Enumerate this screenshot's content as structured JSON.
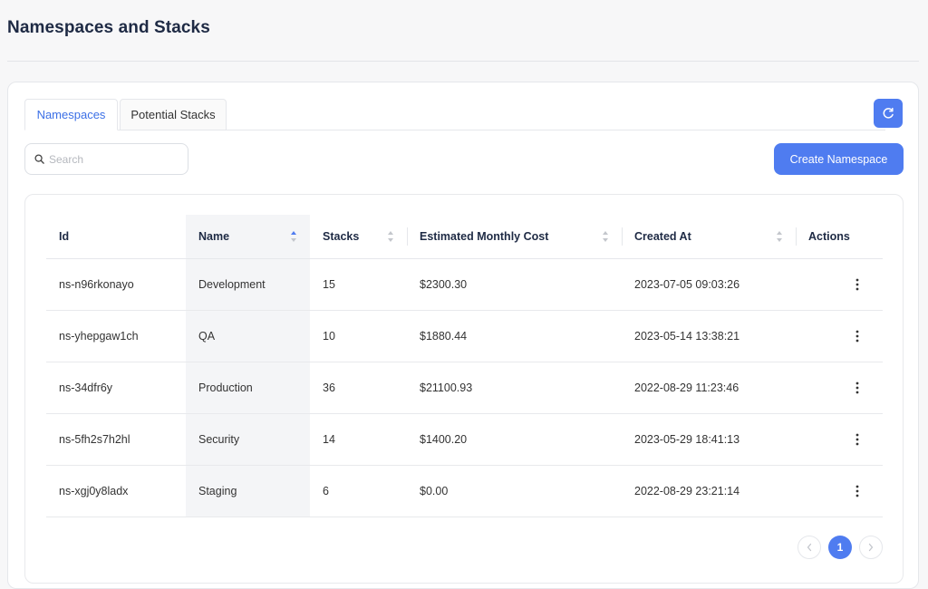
{
  "page": {
    "title": "Namespaces and Stacks"
  },
  "tabs": [
    {
      "label": "Namespaces",
      "active": true
    },
    {
      "label": "Potential Stacks",
      "active": false
    }
  ],
  "search": {
    "placeholder": "Search",
    "value": ""
  },
  "toolbar": {
    "create_label": "Create Namespace"
  },
  "table": {
    "columns": [
      "Id",
      "Name",
      "Stacks",
      "Estimated Monthly Cost",
      "Created At",
      "Actions"
    ],
    "sorted_column": "Name",
    "rows": [
      {
        "id": "ns-n96rkonayo",
        "name": "Development",
        "stacks": "15",
        "cost": "$2300.30",
        "created": "2023-07-05 09:03:26"
      },
      {
        "id": "ns-yhepgaw1ch",
        "name": "QA",
        "stacks": "10",
        "cost": "$1880.44",
        "created": "2023-05-14 13:38:21"
      },
      {
        "id": "ns-34dfr6y",
        "name": "Production",
        "stacks": "36",
        "cost": "$21100.93",
        "created": "2022-08-29 11:23:46"
      },
      {
        "id": "ns-5fh2s7h2hl",
        "name": "Security",
        "stacks": "14",
        "cost": "$1400.20",
        "created": "2023-05-29 18:41:13"
      },
      {
        "id": "ns-xgj0y8ladx",
        "name": "Staging",
        "stacks": "6",
        "cost": "$0.00",
        "created": "2022-08-29 23:21:14"
      }
    ]
  },
  "pagination": {
    "current_page": "1"
  },
  "colors": {
    "accent": "#4f7cf0",
    "active_tab_text": "#3b6fe6",
    "title": "#1e2a44"
  },
  "icons": [
    "refresh-icon",
    "search-icon",
    "sort-icon",
    "kebab-menu-icon",
    "chevron-left-icon",
    "chevron-right-icon"
  ]
}
